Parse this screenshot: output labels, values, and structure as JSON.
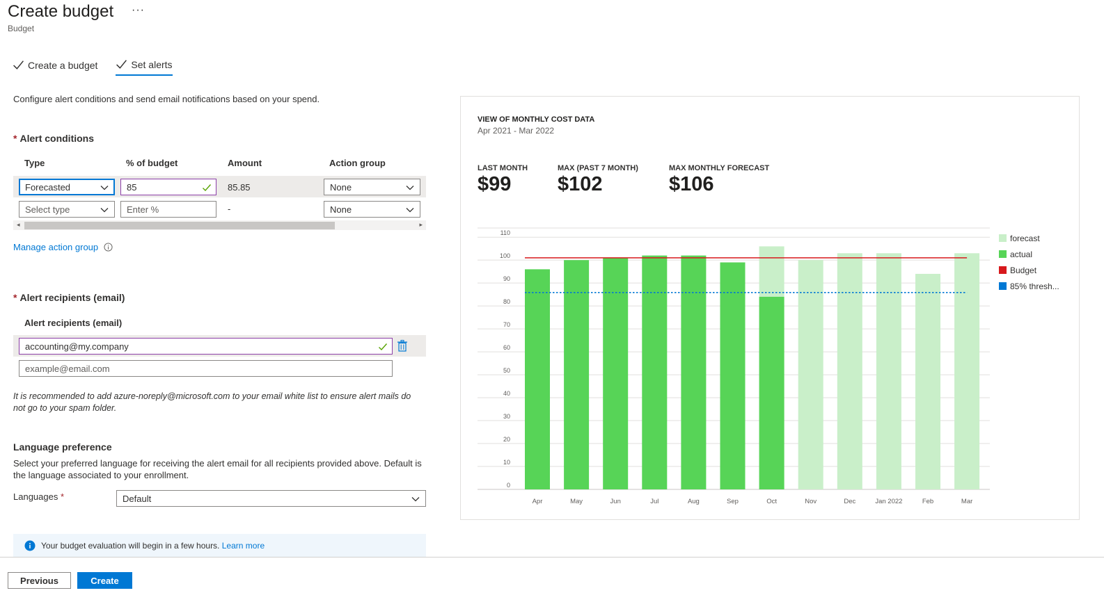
{
  "header": {
    "title": "Create budget",
    "more": "···",
    "subtitle": "Budget"
  },
  "steps": [
    {
      "label": "Create a budget"
    },
    {
      "label": "Set alerts"
    }
  ],
  "description": "Configure alert conditions and send email notifications based on your spend.",
  "alert_conditions": {
    "heading": "Alert conditions",
    "columns": [
      "Type",
      "% of budget",
      "Amount",
      "Action group"
    ],
    "rows": [
      {
        "type": "Forecasted",
        "percent": "85",
        "amount": "85.85",
        "action": "None"
      },
      {
        "type_placeholder": "Select type",
        "percent_placeholder": "Enter %",
        "amount": "-",
        "action": "None"
      }
    ]
  },
  "manage_link": "Manage action group",
  "recipients": {
    "heading": "Alert recipients (email)",
    "label": "Alert recipients (email)",
    "value": "accounting@my.company",
    "placeholder": "example@email.com"
  },
  "whitelist_note": "It is recommended to add azure-noreply@microsoft.com to your email white list to ensure alert mails do not go to your spam folder.",
  "language": {
    "heading": "Language preference",
    "description": "Select your preferred language for receiving the alert email for all recipients provided above. Default is the language associated to your enrollment.",
    "label": "Languages",
    "value": "Default"
  },
  "info_bar": {
    "text": "Your budget evaluation will begin in a few hours.",
    "link": "Learn more"
  },
  "footer": {
    "previous": "Previous",
    "create": "Create"
  },
  "panel": {
    "title": "VIEW OF MONTHLY COST DATA",
    "range": "Apr 2021 - Mar 2022",
    "kpis": [
      {
        "label": "LAST MONTH",
        "value": "$99"
      },
      {
        "label": "MAX (PAST 7 MONTH)",
        "value": "$102"
      },
      {
        "label": "MAX MONTHLY FORECAST",
        "value": "$106"
      }
    ]
  },
  "colors": {
    "actual": "#57d457",
    "forecast": "#c9efc9",
    "budget": "#d7191c",
    "threshold": "#0078d4",
    "accent": "#0078d4"
  },
  "chart_data": {
    "type": "bar",
    "categories": [
      "Apr",
      "May",
      "Jun",
      "Jul",
      "Aug",
      "Sep",
      "Oct",
      "Nov",
      "Dec",
      "Jan 2022",
      "Feb",
      "Mar"
    ],
    "series": [
      {
        "name": "forecast",
        "values": [
          null,
          null,
          null,
          null,
          null,
          null,
          106,
          100,
          103,
          103,
          94,
          103
        ]
      },
      {
        "name": "actual",
        "values": [
          96,
          100,
          101,
          102,
          102,
          99,
          84,
          null,
          null,
          null,
          null,
          null
        ]
      },
      {
        "name": "Budget",
        "values": [
          101,
          101,
          101,
          101,
          101,
          101,
          101,
          101,
          101,
          101,
          101,
          101
        ]
      },
      {
        "name": "85% thresh...",
        "values": [
          85.85,
          85.85,
          85.85,
          85.85,
          85.85,
          85.85,
          85.85,
          85.85,
          85.85,
          85.85,
          85.85,
          85.85
        ]
      }
    ],
    "yticks": [
      0,
      10,
      20,
      30,
      40,
      50,
      60,
      70,
      80,
      90,
      100,
      110
    ],
    "ylim": [
      0,
      114
    ],
    "grid": true,
    "legend": "right"
  }
}
